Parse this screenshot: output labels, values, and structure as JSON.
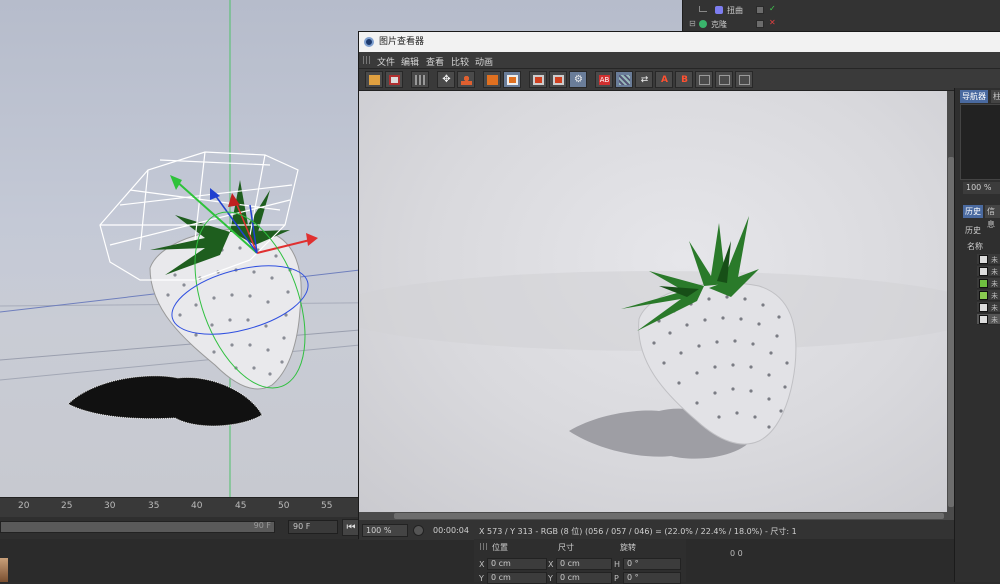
{
  "viewport": {
    "ruler_labels": [
      "20",
      "25",
      "30",
      "35",
      "40",
      "45",
      "50",
      "55"
    ],
    "frame_end": "90 F",
    "frame_max": "90 F"
  },
  "object_manager": {
    "rows": [
      {
        "label": "扭曲",
        "icon": "bend-deformer-icon"
      },
      {
        "label": "克隆",
        "icon": "cloner-icon"
      }
    ]
  },
  "picture_viewer": {
    "title": "图片查看器",
    "menu": [
      "文件",
      "编辑",
      "查看",
      "比较",
      "动画"
    ],
    "status": {
      "zoom": "100 %",
      "timecode": "00:00:04",
      "pixel_info": "X 573 / Y 313 - RGB (8 位) (056 / 057 / 046) = (22.0% / 22.4% / 18.0%) - 尺寸: 1"
    }
  },
  "navigator": {
    "tabs": [
      "导航器",
      "柱"
    ],
    "zoom": "100 %",
    "history_tabs": [
      "历史",
      "信息"
    ],
    "history_label": "历史",
    "name_header": "名称",
    "history_items": [
      "未",
      "未",
      "未",
      "未",
      "未",
      "未"
    ]
  },
  "coordinates": {
    "headers": [
      "位置",
      "尺寸",
      "旋转"
    ],
    "row1": {
      "x_label": "X",
      "x_pos": "0 cm",
      "x2_label": "X",
      "x_size": "0 cm",
      "h_label": "H",
      "h_rot": "0 °"
    },
    "row2": {
      "y_label": "Y",
      "y_pos": "0 cm",
      "y2_label": "Y",
      "y_size": "0 cm",
      "p_label": "P",
      "p_rot": "0 °"
    },
    "right_value": "0 0"
  },
  "colors": {
    "viewer_bg": "#d9d9dd",
    "toolbar_highlight": "#6a7d99",
    "axis_x": "#e03030",
    "axis_y": "#30c040",
    "axis_z": "#3050e0"
  }
}
